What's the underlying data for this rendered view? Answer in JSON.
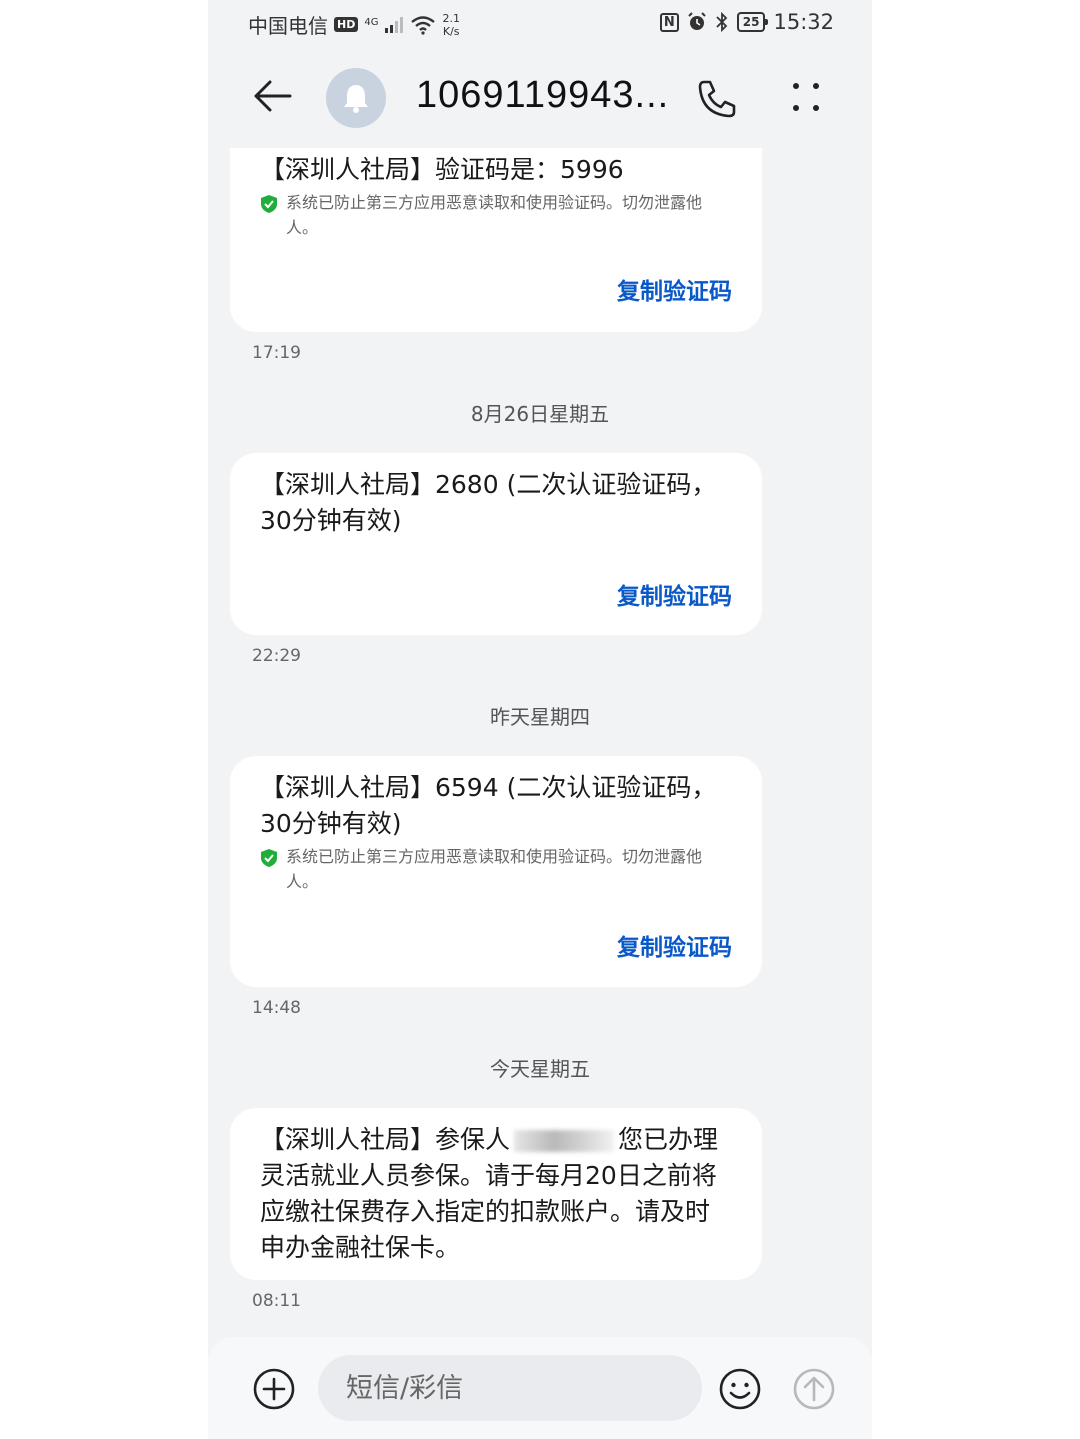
{
  "status_bar": {
    "carrier": "中国电信",
    "hd": "HD",
    "network": "4G",
    "speed_value": "2.1",
    "speed_unit": "K/s",
    "nfc": "N",
    "battery": "25",
    "time": "15:32"
  },
  "header": {
    "contact": "1069119943..."
  },
  "messages": [
    {
      "text": "【深圳人社局】验证码是：5996",
      "security_note": "系统已防止第三方应用恶意读取和使用验证码。切勿泄露他人。",
      "action": "复制验证码",
      "time": "17:19"
    },
    {
      "date": "8月26日星期五",
      "text": "【深圳人社局】2680 (二次认证验证码，30分钟有效)",
      "action": "复制验证码",
      "time": "22:29"
    },
    {
      "date": "昨天星期四",
      "text": "【深圳人社局】6594 (二次认证验证码，30分钟有效)",
      "security_note": "系统已防止第三方应用恶意读取和使用验证码。切勿泄露他人。",
      "action": "复制验证码",
      "time": "14:48"
    },
    {
      "date": "今天星期五",
      "text_before": "【深圳人社局】参保人",
      "text_after": "您已办理灵活就业人员参保。请于每月20日之前将应缴社保费存入指定的扣款账户。请及时申办金融社保卡。",
      "time": "08:11"
    }
  ],
  "composer": {
    "placeholder": "短信/彩信"
  },
  "colors": {
    "background": "#f1f3f5",
    "bubble": "#ffffff",
    "link": "#0a59c8",
    "shield": "#1fae3a"
  }
}
